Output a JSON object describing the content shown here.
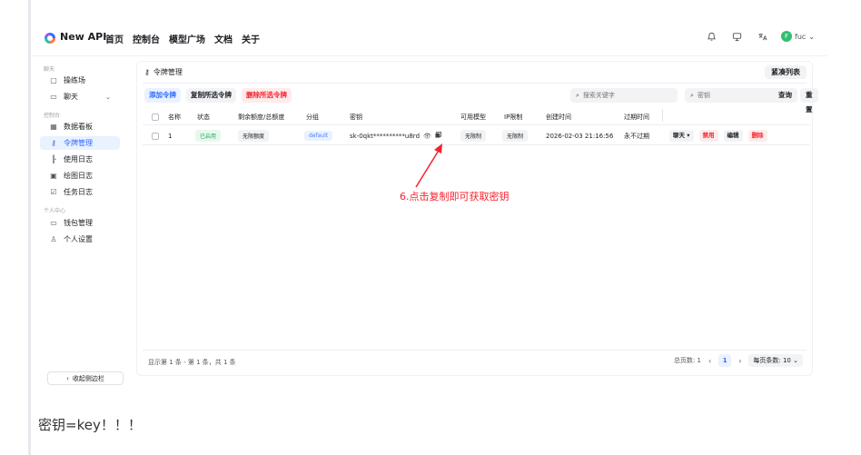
{
  "header": {
    "brand": "New API",
    "nav": [
      "首页",
      "控制台",
      "模型广场",
      "文档",
      "关于"
    ],
    "user_initial": "F",
    "user_name": "fuc"
  },
  "sidebar": {
    "section_chat": "聊天",
    "section_console": "控制台",
    "section_personal": "个人中心",
    "items": [
      {
        "label": "操练场",
        "icon": "playground-icon"
      },
      {
        "label": "聊天",
        "icon": "chat-icon"
      },
      {
        "label": "数据看板",
        "icon": "dashboard-icon"
      },
      {
        "label": "令牌管理",
        "icon": "key-icon"
      },
      {
        "label": "使用日志",
        "icon": "chart-icon"
      },
      {
        "label": "绘图日志",
        "icon": "image-icon"
      },
      {
        "label": "任务日志",
        "icon": "task-icon"
      },
      {
        "label": "钱包管理",
        "icon": "wallet-icon"
      },
      {
        "label": "个人设置",
        "icon": "user-icon"
      }
    ],
    "collapse_label": "收起侧边栏"
  },
  "main": {
    "title": "令牌管理",
    "compact_btn": "紧凑列表",
    "toolbar": {
      "add": "添加令牌",
      "copy_selected": "复制所选令牌",
      "delete_selected": "删除所选令牌"
    },
    "search_keyword_placeholder": "搜索关键字",
    "search_key_placeholder": "密钥",
    "query_btn": "查询",
    "reset_btn": "重置",
    "columns": [
      "名称",
      "状态",
      "剩余额度/总额度",
      "分组",
      "密钥",
      "可用模型",
      "IP限制",
      "创建时间",
      "过期时间"
    ],
    "row": {
      "name": "1",
      "status": "已启用",
      "quota": "无限额度",
      "group": "default",
      "key": "sk-0qkt**********u8rd",
      "models": "无限制",
      "ip": "无限制",
      "created": "2026-02-03 21:16:56",
      "expires": "永不过期",
      "actions": {
        "chat": "聊天",
        "disable": "禁用",
        "edit": "编辑",
        "delete": "删除"
      }
    },
    "summary": "显示第 1 条 - 第 1 条，共 1 条",
    "pager": {
      "total_pages": "总页数: 1",
      "current": "1",
      "page_size": "每页条数: 10"
    }
  },
  "annotation": {
    "text": "6.点击复制即可获取密钥",
    "color": "#f5222d"
  },
  "caption": "密钥=key！！！",
  "colors": {
    "accent": "#2f6bff",
    "danger": "#f5222d",
    "success": "#27a760"
  }
}
